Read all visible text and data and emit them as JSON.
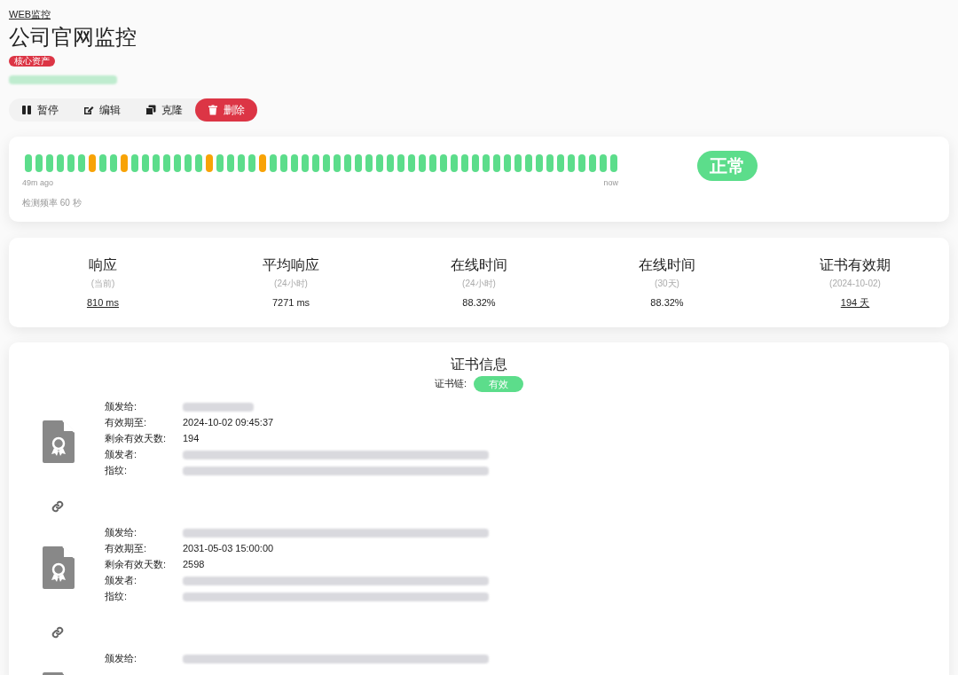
{
  "breadcrumb": "WEB监控",
  "title": "公司官网监控",
  "tags": [
    {
      "label": "核心资产",
      "color": "#dc3545"
    }
  ],
  "url": {
    "blurred": true
  },
  "actions": [
    {
      "label": "暂停",
      "kind": "pause"
    },
    {
      "label": "编辑",
      "kind": "edit"
    },
    {
      "label": "克隆",
      "kind": "clone"
    },
    {
      "label": "删除",
      "kind": "delete"
    }
  ],
  "heartbeat": {
    "beats": [
      {
        "color": "#5cdd8b"
      },
      {
        "color": "#5cdd8b"
      },
      {
        "color": "#5cdd8b"
      },
      {
        "color": "#5cdd8b"
      },
      {
        "color": "#5cdd8b"
      },
      {
        "color": "#5cdd8b"
      },
      {
        "color": "#f8a306"
      },
      {
        "color": "#5cdd8b"
      },
      {
        "color": "#5cdd8b"
      },
      {
        "color": "#f8a306"
      },
      {
        "color": "#5cdd8b"
      },
      {
        "color": "#5cdd8b"
      },
      {
        "color": "#5cdd8b"
      },
      {
        "color": "#5cdd8b"
      },
      {
        "color": "#5cdd8b"
      },
      {
        "color": "#5cdd8b"
      },
      {
        "color": "#5cdd8b"
      },
      {
        "color": "#f8a306"
      },
      {
        "color": "#5cdd8b"
      },
      {
        "color": "#5cdd8b"
      },
      {
        "color": "#5cdd8b"
      },
      {
        "color": "#5cdd8b"
      },
      {
        "color": "#f8a306"
      },
      {
        "color": "#5cdd8b"
      },
      {
        "color": "#5cdd8b"
      },
      {
        "color": "#5cdd8b"
      },
      {
        "color": "#5cdd8b"
      },
      {
        "color": "#5cdd8b"
      },
      {
        "color": "#5cdd8b"
      },
      {
        "color": "#5cdd8b"
      },
      {
        "color": "#5cdd8b"
      },
      {
        "color": "#5cdd8b"
      },
      {
        "color": "#5cdd8b"
      },
      {
        "color": "#5cdd8b"
      },
      {
        "color": "#5cdd8b"
      },
      {
        "color": "#5cdd8b"
      },
      {
        "color": "#5cdd8b"
      },
      {
        "color": "#5cdd8b"
      },
      {
        "color": "#5cdd8b"
      },
      {
        "color": "#5cdd8b"
      },
      {
        "color": "#5cdd8b"
      },
      {
        "color": "#5cdd8b"
      },
      {
        "color": "#5cdd8b"
      },
      {
        "color": "#5cdd8b"
      },
      {
        "color": "#5cdd8b"
      },
      {
        "color": "#5cdd8b"
      },
      {
        "color": "#5cdd8b"
      },
      {
        "color": "#5cdd8b"
      },
      {
        "color": "#5cdd8b"
      },
      {
        "color": "#5cdd8b"
      },
      {
        "color": "#5cdd8b"
      },
      {
        "color": "#5cdd8b"
      },
      {
        "color": "#5cdd8b"
      },
      {
        "color": "#5cdd8b"
      },
      {
        "color": "#5cdd8b"
      },
      {
        "color": "#5cdd8b"
      }
    ],
    "start_label": "49m ago",
    "end_label": "now",
    "interval": "检测频率 60 秒",
    "status": "正常"
  },
  "stats": [
    {
      "title": "响应",
      "sub": "(当前)",
      "value": "810 ms",
      "link": true
    },
    {
      "title": "平均响应",
      "sub": "(24小时)",
      "value": "7271 ms",
      "link": false
    },
    {
      "title": "在线时间",
      "sub": "(24小时)",
      "value": "88.32%",
      "link": false
    },
    {
      "title": "在线时间",
      "sub": "(30天)",
      "value": "88.32%",
      "link": false
    },
    {
      "title": "证书有效期",
      "sub": "(2024-10-02)",
      "value": "194 天",
      "link": true
    }
  ],
  "certificate": {
    "title": "证书信息",
    "chain_label": "证书链:",
    "chain_status": "有效",
    "certs": [
      {
        "rows": [
          {
            "label": "颁发给:"
          },
          {
            "label": "有效期至:",
            "value": "2024-10-02 09:45:37"
          },
          {
            "label": "剩余有效天数:",
            "value": "194"
          },
          {
            "label": "颁发者:"
          },
          {
            "label": "指纹:"
          }
        ]
      },
      {
        "rows": [
          {
            "label": "颁发给:"
          },
          {
            "label": "有效期至:",
            "value": "2031-05-03 15:00:00"
          },
          {
            "label": "剩余有效天数:",
            "value": "2598"
          },
          {
            "label": "颁发者:"
          },
          {
            "label": "指纹:"
          }
        ]
      },
      {
        "rows": [
          {
            "label": "颁发给:"
          }
        ]
      }
    ]
  }
}
